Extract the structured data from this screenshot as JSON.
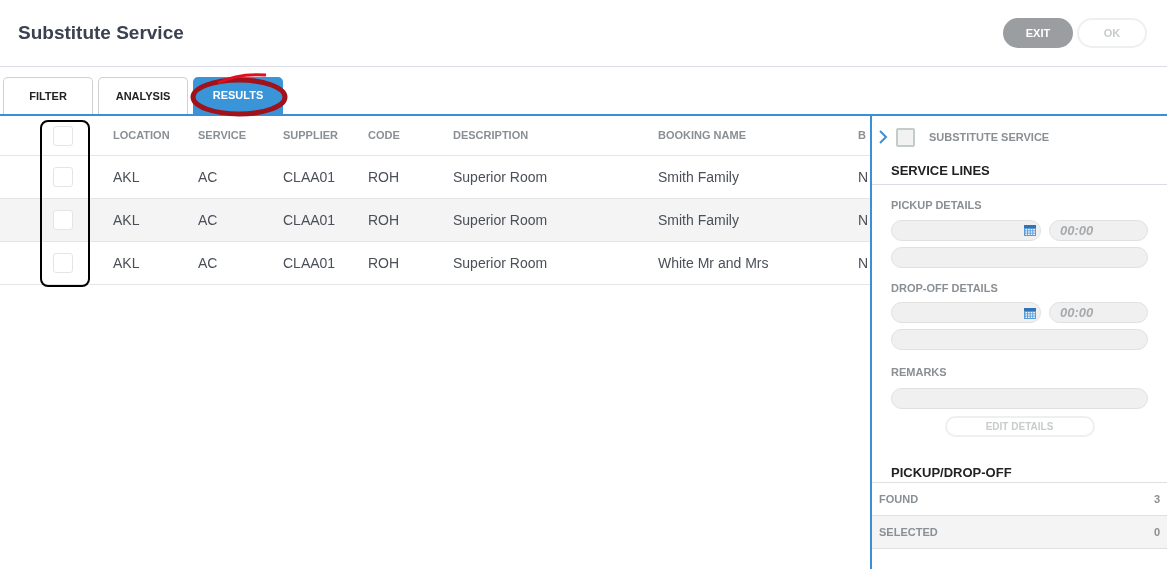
{
  "title": "Substitute Service",
  "actions": [
    {
      "label": "EXIT",
      "disabled": false
    },
    {
      "label": "OK",
      "disabled": true
    }
  ],
  "tabs": [
    {
      "label": "FILTER",
      "selected": false
    },
    {
      "label": "ANALYSIS",
      "selected": false
    },
    {
      "label": "RESULTS",
      "selected": true
    }
  ],
  "table": {
    "columns": [
      "LOCATION",
      "SERVICE",
      "SUPPLIER",
      "CODE",
      "DESCRIPTION",
      "BOOKING NAME",
      "B"
    ],
    "header_checked": false,
    "rows": [
      {
        "checked": false,
        "cells": [
          "AKL",
          "AC",
          "CLAA01",
          "ROH",
          "Superior Room",
          "Smith Family",
          "N"
        ]
      },
      {
        "checked": false,
        "cells": [
          "AKL",
          "AC",
          "CLAA01",
          "ROH",
          "Superior Room",
          "Smith Family",
          "N"
        ]
      },
      {
        "checked": false,
        "cells": [
          "AKL",
          "AC",
          "CLAA01",
          "ROH",
          "Superior Room",
          "White Mr and Mrs",
          "N"
        ]
      }
    ]
  },
  "panel": {
    "substitute": {
      "label": "SUBSTITUTE SERVICE",
      "checked": false
    },
    "section_title": "SERVICE LINES",
    "groups": [
      {
        "label": "PICKUP DETAILS",
        "time_placeholder": "00:00"
      },
      {
        "label": "DROP-OFF DETAILS",
        "time_placeholder": "00:00"
      }
    ],
    "remarks_label": "REMARKS",
    "edit_button": {
      "label": "EDIT DETAILS",
      "disabled": true
    },
    "second_section": "PICKUP/DROP-OFF"
  },
  "summary": [
    {
      "label": "FOUND",
      "value": "3"
    },
    {
      "label": "SELECTED",
      "value": "0"
    }
  ]
}
